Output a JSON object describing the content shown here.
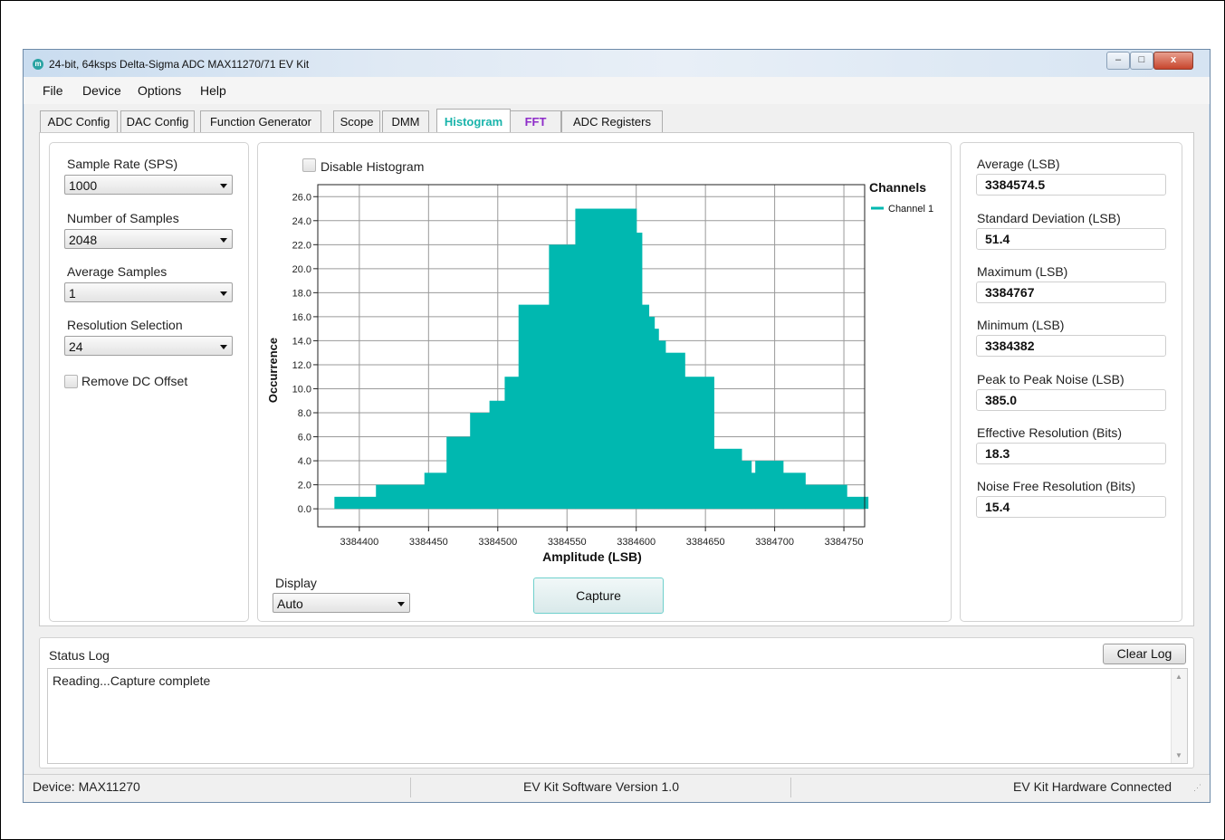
{
  "window": {
    "title": "24-bit, 64ksps Delta-Sigma ADC MAX11270/71 EV Kit",
    "logo_icon": "maxim-logo-icon",
    "controls": {
      "minimize": "–",
      "maximize": "□",
      "close": "x"
    }
  },
  "menu": [
    "File",
    "Device",
    "Options",
    "Help"
  ],
  "tabs": [
    {
      "label": "ADC Config",
      "active": false
    },
    {
      "label": "DAC Config",
      "active": false
    },
    {
      "label": "Function Generator",
      "active": false
    },
    {
      "label": "Scope",
      "active": false
    },
    {
      "label": "DMM",
      "active": false
    },
    {
      "label": "Histogram",
      "active": true
    },
    {
      "label": "FFT",
      "active": false
    },
    {
      "label": "ADC Registers",
      "active": false
    }
  ],
  "colors": {
    "accent": "#1ab4ab",
    "fft_tab": "#8e2cc9",
    "histogram_fill": "#00b8b0"
  },
  "left": {
    "sample_rate": {
      "label": "Sample Rate (SPS)",
      "value": "1000"
    },
    "num_samples": {
      "label": "Number of Samples",
      "value": "2048"
    },
    "avg_samples": {
      "label": "Average Samples",
      "value": "1"
    },
    "resolution": {
      "label": "Resolution Selection",
      "value": "24"
    },
    "remove_dc": {
      "label": "Remove DC Offset",
      "checked": false
    }
  },
  "center": {
    "disable_histogram": {
      "label": "Disable Histogram",
      "checked": false
    },
    "display": {
      "label": "Display",
      "value": "Auto"
    },
    "capture_label": "Capture"
  },
  "chart_data": {
    "type": "bar",
    "xlabel": "Amplitude (LSB)",
    "ylabel": "Occurrence",
    "xlim": [
      3384370,
      3384765
    ],
    "ylim": [
      -1.5,
      27
    ],
    "xticks": [
      3384400,
      3384450,
      3384500,
      3384550,
      3384600,
      3384650,
      3384700,
      3384750
    ],
    "yticks": [
      0.0,
      2.0,
      4.0,
      6.0,
      8.0,
      10.0,
      12.0,
      14.0,
      16.0,
      18.0,
      20.0,
      22.0,
      24.0,
      26.0
    ],
    "legend": {
      "title": "Channels",
      "position": "right"
    },
    "grid": true,
    "series": [
      {
        "name": "Channel 1",
        "x": [
          3384382,
          3384412,
          3384447,
          3384463,
          3384480,
          3384494,
          3384505,
          3384515,
          3384537,
          3384556,
          3384600,
          3384604,
          3384609,
          3384613,
          3384616,
          3384621,
          3384635,
          3384656,
          3384676,
          3384683,
          3384686,
          3384706,
          3384722,
          3384752,
          3384767
        ],
        "y": [
          1,
          2,
          3,
          6,
          8,
          9,
          11,
          17,
          22,
          25,
          23,
          17,
          16,
          15,
          14,
          13,
          11,
          5,
          4,
          3,
          4,
          3,
          2,
          1,
          1
        ]
      }
    ]
  },
  "right": {
    "stats": [
      {
        "label": "Average (LSB)",
        "value": "3384574.5"
      },
      {
        "label": "Standard Deviation (LSB)",
        "value": "51.4"
      },
      {
        "label": "Maximum (LSB)",
        "value": "3384767"
      },
      {
        "label": "Minimum (LSB)",
        "value": "3384382"
      },
      {
        "label": "Peak to Peak Noise (LSB)",
        "value": "385.0"
      },
      {
        "label": "Effective Resolution (Bits)",
        "value": "18.3"
      },
      {
        "label": "Noise Free Resolution (Bits)",
        "value": "15.4"
      }
    ]
  },
  "status_log": {
    "label": "Status Log",
    "clear_label": "Clear Log",
    "text": "Reading...Capture complete"
  },
  "statusbar": {
    "device": "Device: MAX11270",
    "version": "EV Kit Software Version 1.0",
    "connection": "EV Kit Hardware Connected"
  }
}
